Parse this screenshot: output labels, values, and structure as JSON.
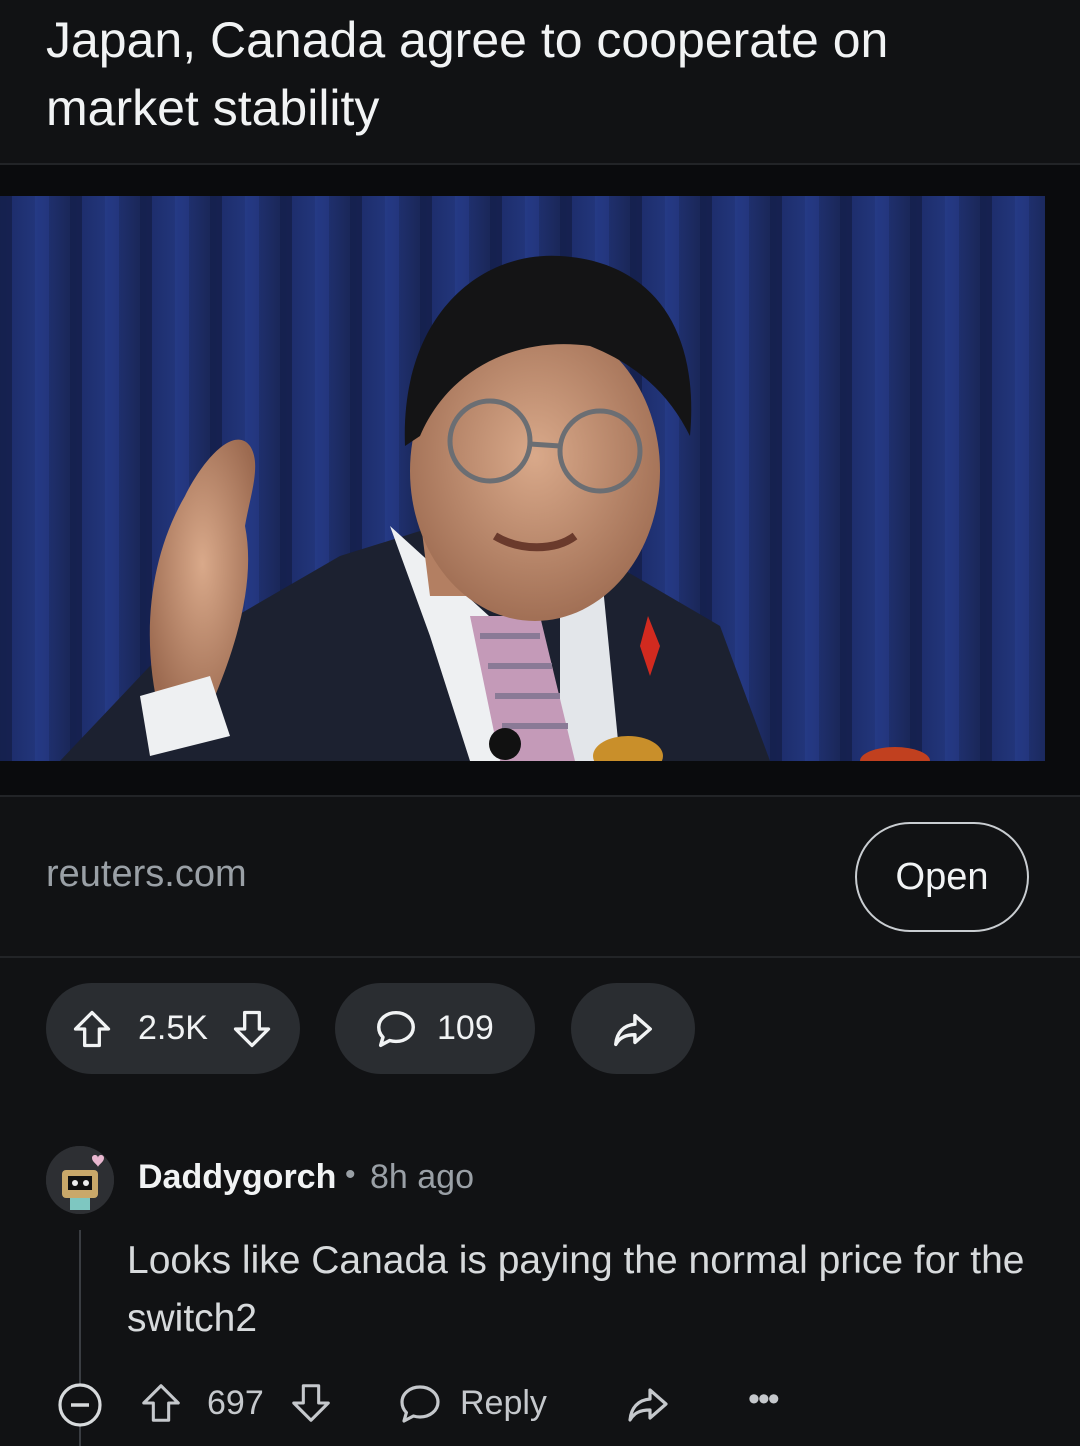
{
  "post": {
    "title": "Japan, Canada agree to cooperate on market stability",
    "link_domain": "reuters.com",
    "open_label": "Open",
    "score": "2.5K",
    "comment_count": "109"
  },
  "comment": {
    "username": "Daddygorch",
    "separator": "•",
    "time": "8h ago",
    "body": "Looks like Canada is paying the normal price for the switch2",
    "score": "697",
    "reply_label": "Reply",
    "more_label": "•••"
  },
  "icons": {
    "upvote": "upvote-arrow-icon",
    "downvote": "downvote-arrow-icon",
    "comment": "speech-bubble-icon",
    "share": "share-arrow-icon",
    "collapse": "collapse-minus-icon",
    "more": "more-dots-icon"
  },
  "colors": {
    "background": "#111214",
    "pill": "#2a2d31",
    "text_primary": "#f1f3f4",
    "text_secondary": "#9aa0a6"
  }
}
